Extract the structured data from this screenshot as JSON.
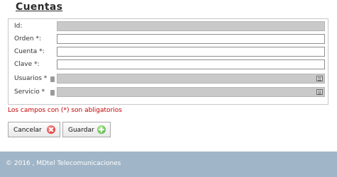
{
  "page": {
    "title": "Cuentas"
  },
  "form": {
    "fields": [
      {
        "label": "Id:",
        "value": ""
      },
      {
        "label": "Orden *:",
        "value": ""
      },
      {
        "label": "Cuenta *:",
        "value": ""
      },
      {
        "label": "Clave *:",
        "value": ""
      },
      {
        "label": "Usuarios *",
        "value": ""
      },
      {
        "label": "Servicio *",
        "value": ""
      }
    ],
    "required_message": "Los campos con (*) son abligatorios"
  },
  "buttons": {
    "cancel": "Cancelar",
    "save": "Guardar"
  },
  "icons": {
    "cancel": "cancel-icon",
    "save": "add-icon",
    "list": "list-icon",
    "required": "required-icon"
  },
  "colors": {
    "footer": "#a0b5c7",
    "message": "#c00000",
    "readonly_field": "#c9c9c9"
  },
  "footer": {
    "text": "© 2016 , MDtel Telecomunicaciones"
  }
}
